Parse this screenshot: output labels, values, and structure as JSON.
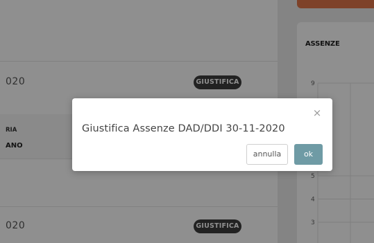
{
  "list": {
    "rows": [
      {
        "date_fragment": "020",
        "action_label": "GIUSTIFICA"
      },
      {
        "date_fragment": "020",
        "action_label": "GIUSTIFICA"
      }
    ],
    "table": {
      "column_header_fragment": "RIA",
      "value_fragment": "ANO"
    }
  },
  "chart_data": {
    "type": "line",
    "title": "ASSENZE",
    "y_ticks": [
      9,
      5,
      4,
      3
    ],
    "series": [],
    "grid": true
  },
  "modal": {
    "message": "Giustifica Assenze DAD/DDI 30-11-2020",
    "close_symbol": "×",
    "cancel_label": "annulla",
    "ok_label": "ok"
  },
  "colors": {
    "accent": "#e0764a",
    "ok_button": "#6f9ba5",
    "badge": "#3d3d3d"
  }
}
